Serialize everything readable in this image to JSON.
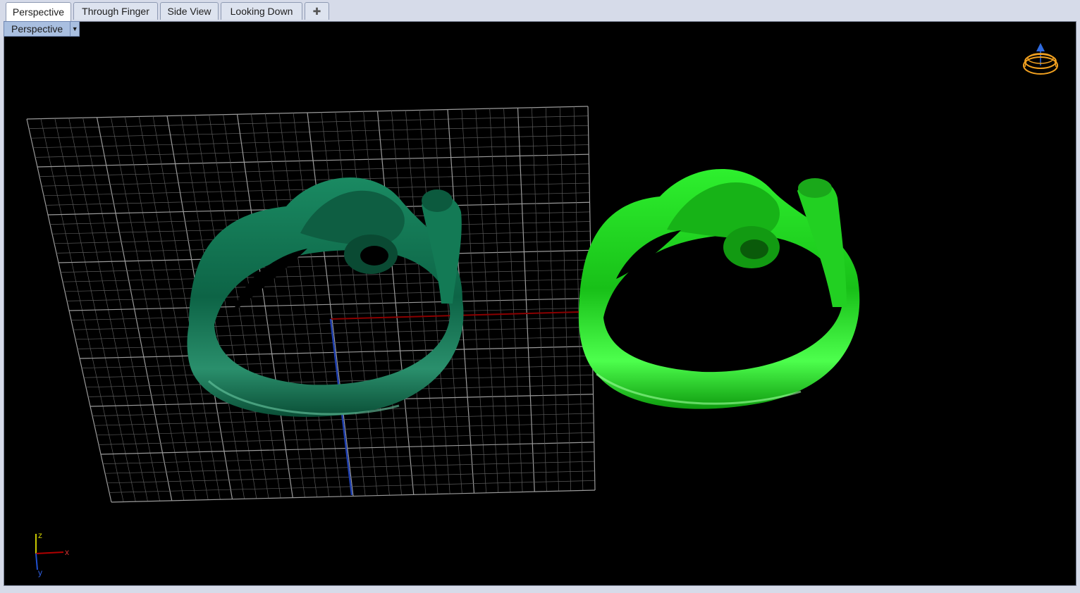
{
  "tabs": [
    {
      "label": "Perspective",
      "active": true
    },
    {
      "label": "Through Finger",
      "active": false
    },
    {
      "label": "Side View",
      "active": false
    },
    {
      "label": "Looking Down",
      "active": false
    }
  ],
  "viewport": {
    "title": "Perspective",
    "axis_labels": {
      "z": "z",
      "x": "x",
      "y": "y"
    }
  },
  "colors": {
    "background": "#000000",
    "grid": "#8a8a8a",
    "x_axis": "#8b0000",
    "y_axis": "#1e3fb0",
    "ring_dark": "#0f6b4a",
    "ring_bright": "#1fd61f",
    "gizmo": "#f0a020"
  },
  "icons": {
    "new_tab": "plus-icon",
    "dropdown": "chevron-down-icon",
    "view_gizmo": "ring-gizmo-icon"
  }
}
